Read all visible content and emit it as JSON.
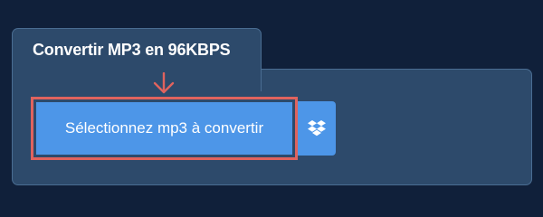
{
  "panel": {
    "title": "Convertir MP3 en 96KBPS"
  },
  "upload": {
    "select_button_label": "Sélectionnez mp3 à convertir",
    "dropbox_icon": "dropbox-icon",
    "arrow_icon": "arrow-down-icon"
  },
  "colors": {
    "page_background": "#10203a",
    "panel_background": "#2d4a6b",
    "panel_border": "#4a6d92",
    "button_primary": "#4d96e8",
    "highlight": "#e0635e",
    "text": "#ffffff"
  }
}
